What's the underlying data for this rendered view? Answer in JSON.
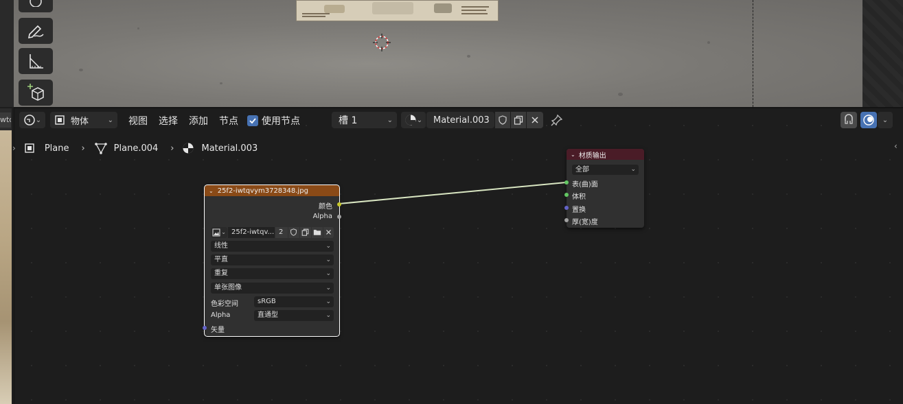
{
  "header": {
    "editor_type_icon": "node-editor-icon",
    "object_mode_label": "物体",
    "menus": [
      "视图",
      "选择",
      "添加",
      "节点"
    ],
    "use_nodes_label": "使用节点",
    "use_nodes_checked": true,
    "slot_label": "槽 1",
    "material_name": "Material.003"
  },
  "breadcrumb": {
    "object": "Plane",
    "mesh": "Plane.004",
    "material": "Material.003"
  },
  "left_strip": {
    "tab_label": "wtq"
  },
  "image_node": {
    "title": "25f2-iwtqvym3728348.jpg",
    "outputs": [
      "颜色",
      "Alpha"
    ],
    "image_name": "25f2-iwtqv...",
    "user_count": "2",
    "interpolation": "线性",
    "projection": "平直",
    "extension": "重复",
    "source": "单张图像",
    "color_space_label": "色彩空间",
    "color_space_value": "sRGB",
    "alpha_label": "Alpha",
    "alpha_value": "直通型",
    "vector_input": "矢量",
    "header_color": "#8a4a17"
  },
  "output_node": {
    "title": "材质输出",
    "target": "全部",
    "inputs": [
      "表(曲)面",
      "体积",
      "置换",
      "厚(宽)度"
    ],
    "header_color": "#4a1c27"
  },
  "colors": {
    "accent_blue": "#4772b3",
    "socket_color": "#c7c729",
    "socket_shader": "#63c763",
    "socket_vector": "#6363c7",
    "socket_gray": "#a1a1a1",
    "link_color": "#d9e6c2"
  }
}
